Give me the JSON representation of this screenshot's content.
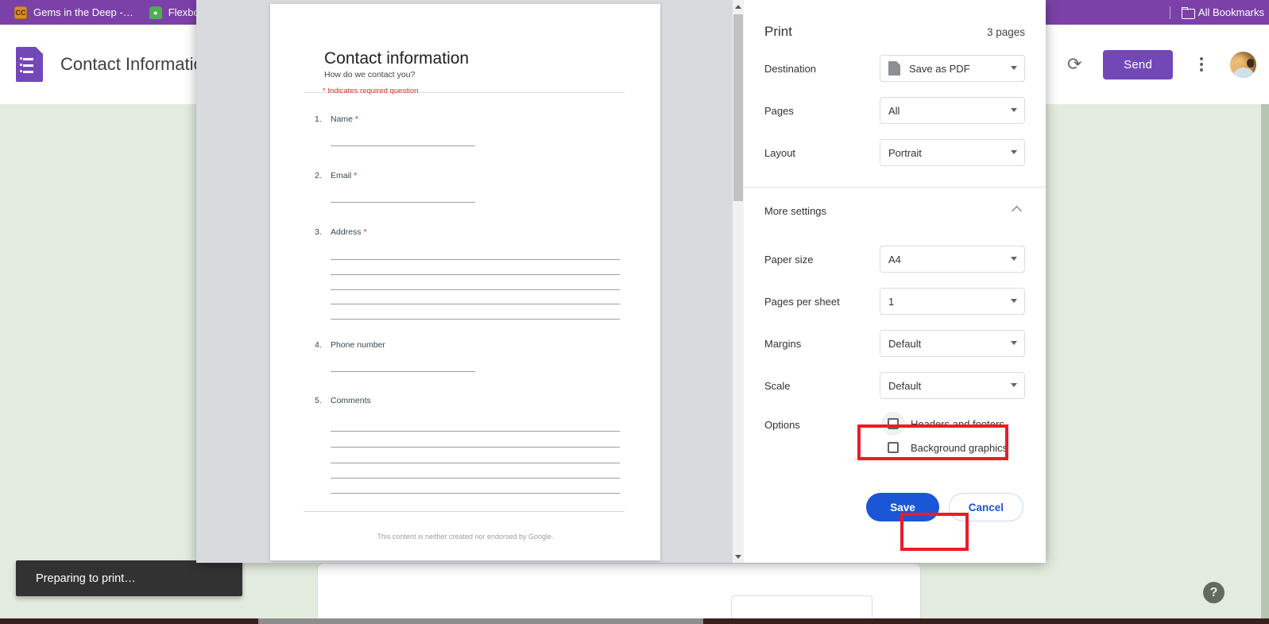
{
  "browser": {
    "bookmarks": [
      {
        "icon": "cc-favicon",
        "label": "Gems in the Deep -…"
      },
      {
        "icon": "frog-favicon",
        "label": "Flexbox Frogg"
      }
    ],
    "all_bookmarks_label": "All Bookmarks",
    "bar_color": "#7B41A8"
  },
  "app": {
    "title": "Contact Information",
    "logo_icon": "google-forms-icon",
    "redo_icon": "redo-icon",
    "send_label": "Send",
    "more_icon": "kebab-menu-icon",
    "avatar_icon": "user-avatar",
    "accent_color": "#7248B9",
    "help_icon": "help-icon",
    "toast_message": "Preparing to print…"
  },
  "print_dialog": {
    "title": "Print",
    "pages_count": "3 pages",
    "rows": [
      {
        "label": "Destination",
        "value": "Save as PDF",
        "icon": "pdf-file-icon"
      },
      {
        "label": "Pages",
        "value": "All",
        "icon": ""
      },
      {
        "label": "Layout",
        "value": "Portrait",
        "icon": ""
      }
    ],
    "more_settings_label": "More settings",
    "more_settings_expanded": true,
    "chevron_icon": "chevron-up-icon",
    "more_rows": [
      {
        "label": "Paper size",
        "value": "A4"
      },
      {
        "label": "Pages per sheet",
        "value": "1"
      },
      {
        "label": "Margins",
        "value": "Default"
      },
      {
        "label": "Scale",
        "value": "Default"
      }
    ],
    "options_label": "Options",
    "options": [
      {
        "label": "Headers and footers",
        "checked": false,
        "highlighted": true
      },
      {
        "label": "Background graphics",
        "checked": false,
        "highlighted": false
      }
    ],
    "save_label": "Save",
    "cancel_label": "Cancel",
    "save_color": "#1a56d6",
    "highlight_color": "#ec1c24",
    "scrollbar": {
      "up_icon": "scroll-up-arrow",
      "down_icon": "scroll-down-arrow"
    }
  },
  "preview": {
    "title": "Contact information",
    "subtitle": "How do we contact you?",
    "required_note": "* Indicates required question",
    "questions": [
      {
        "number": "1.",
        "label": "Name",
        "required": true,
        "lines": 1,
        "line_width": "short"
      },
      {
        "number": "2.",
        "label": "Email",
        "required": true,
        "lines": 1,
        "line_width": "short"
      },
      {
        "number": "3.",
        "label": "Address",
        "required": true,
        "lines": 5,
        "line_width": "long"
      },
      {
        "number": "4.",
        "label": "Phone number",
        "required": false,
        "lines": 1,
        "line_width": "short"
      },
      {
        "number": "5.",
        "label": "Comments",
        "required": false,
        "lines": 5,
        "line_width": "long"
      }
    ],
    "footer": "This content is neither created nor endorsed by Google."
  }
}
